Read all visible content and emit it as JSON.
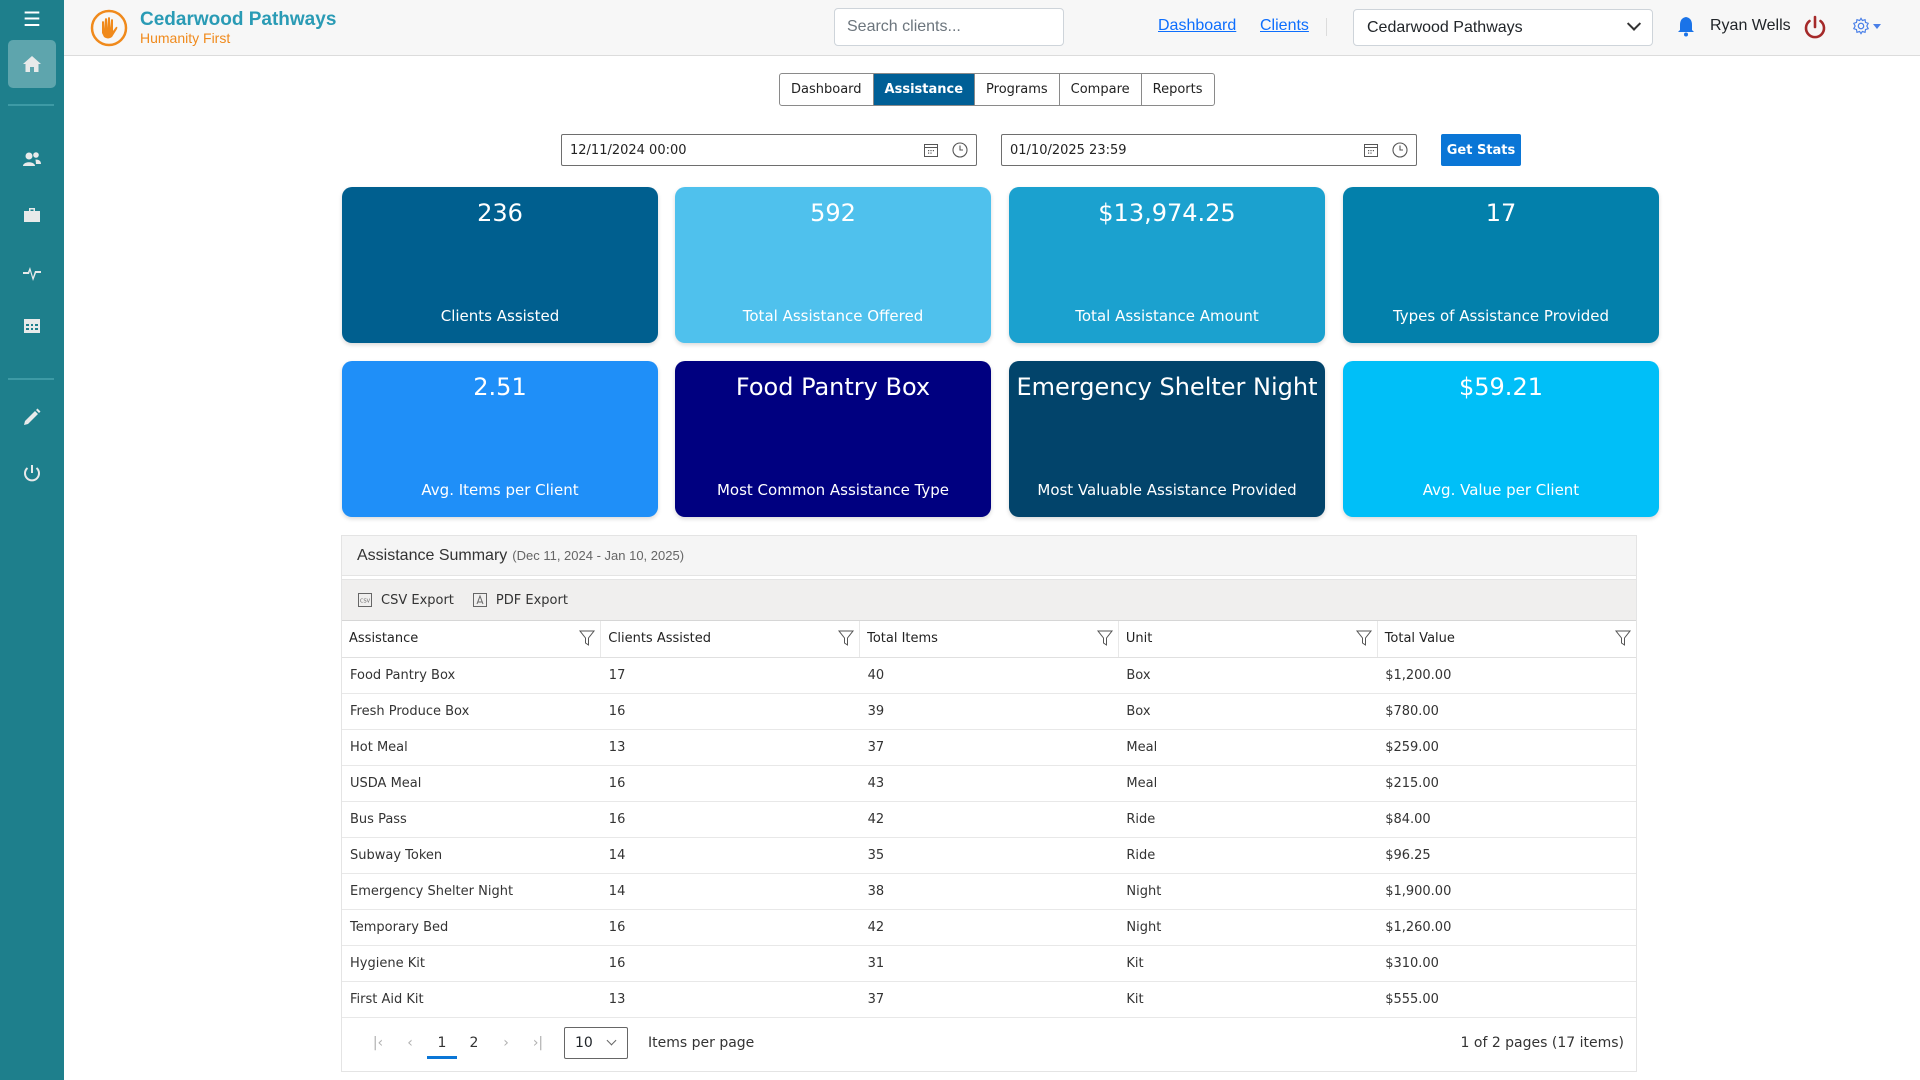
{
  "sidebar": {
    "menu_icon": "hamburger-icon",
    "items": [
      {
        "name": "home",
        "icon": "home-icon",
        "active": true
      },
      {
        "name": "clients",
        "icon": "users-icon",
        "active": false
      },
      {
        "name": "programs",
        "icon": "briefcase-icon",
        "active": false
      },
      {
        "name": "activity",
        "icon": "pulse-icon",
        "active": false
      },
      {
        "name": "calendar",
        "icon": "calendar-icon",
        "active": false
      },
      {
        "name": "edit",
        "icon": "pencil-icon",
        "active": false
      },
      {
        "name": "logout",
        "icon": "power-icon",
        "active": false
      }
    ]
  },
  "header": {
    "brand_title": "Cedarwood Pathways",
    "brand_subtitle": "Humanity First",
    "search_placeholder": "Search clients...",
    "links": [
      "Dashboard",
      "Clients"
    ],
    "org_selected": "Cedarwood Pathways",
    "user_name": "Ryan Wells",
    "colors": {
      "brand": "#2a9bb5",
      "subtitle": "#f08a1c",
      "sidebar": "#1e7f8c",
      "power": "#a52a2a"
    }
  },
  "tabs": [
    {
      "label": "Dashboard",
      "active": false
    },
    {
      "label": "Assistance",
      "active": true
    },
    {
      "label": "Programs",
      "active": false
    },
    {
      "label": "Compare",
      "active": false
    },
    {
      "label": "Reports",
      "active": false
    }
  ],
  "filters": {
    "start": "12/11/2024 00:00",
    "end": "01/10/2025 23:59",
    "button": "Get Stats"
  },
  "cards": [
    {
      "value": "236",
      "label": "Clients Assisted",
      "color": "#005f8f"
    },
    {
      "value": "592",
      "label": "Total Assistance Offered",
      "color": "#4fc1ed"
    },
    {
      "value": "$13,974.25",
      "label": "Total Assistance Amount",
      "color": "#1ba1cf"
    },
    {
      "value": "17",
      "label": "Types of Assistance Provided",
      "color": "#0380ab"
    },
    {
      "value": "2.51",
      "label": "Avg. Items per Client",
      "color": "#1f8ff8"
    },
    {
      "value": "Food Pantry Box",
      "label": "Most Common Assistance Type",
      "color": "#000080"
    },
    {
      "value": "Emergency Shelter Night",
      "label": "Most Valuable Assistance Provided",
      "color": "#02446b"
    },
    {
      "value": "$59.21",
      "label": "Avg. Value per Client",
      "color": "#00bff8"
    }
  ],
  "summary": {
    "title": "Assistance Summary",
    "range": "(Dec 11, 2024 - Jan 10, 2025)",
    "toolbar": {
      "csv": "CSV Export",
      "pdf": "PDF Export"
    },
    "columns": [
      "Assistance",
      "Clients Assisted",
      "Total Items",
      "Unit",
      "Total Value"
    ],
    "rows": [
      [
        "Food Pantry Box",
        "17",
        "40",
        "Box",
        "$1,200.00"
      ],
      [
        "Fresh Produce Box",
        "16",
        "39",
        "Box",
        "$780.00"
      ],
      [
        "Hot Meal",
        "13",
        "37",
        "Meal",
        "$259.00"
      ],
      [
        "USDA Meal",
        "16",
        "43",
        "Meal",
        "$215.00"
      ],
      [
        "Bus Pass",
        "16",
        "42",
        "Ride",
        "$84.00"
      ],
      [
        "Subway Token",
        "14",
        "35",
        "Ride",
        "$96.25"
      ],
      [
        "Emergency Shelter Night",
        "14",
        "38",
        "Night",
        "$1,900.00"
      ],
      [
        "Temporary Bed",
        "16",
        "42",
        "Night",
        "$1,260.00"
      ],
      [
        "Hygiene Kit",
        "16",
        "31",
        "Kit",
        "$310.00"
      ],
      [
        "First Aid Kit",
        "13",
        "37",
        "Kit",
        "$555.00"
      ]
    ],
    "pager": {
      "pages": [
        "1",
        "2"
      ],
      "current": "1",
      "page_size": "10",
      "page_size_label": "Items per page",
      "info": "1 of 2 pages (17 items)"
    }
  }
}
